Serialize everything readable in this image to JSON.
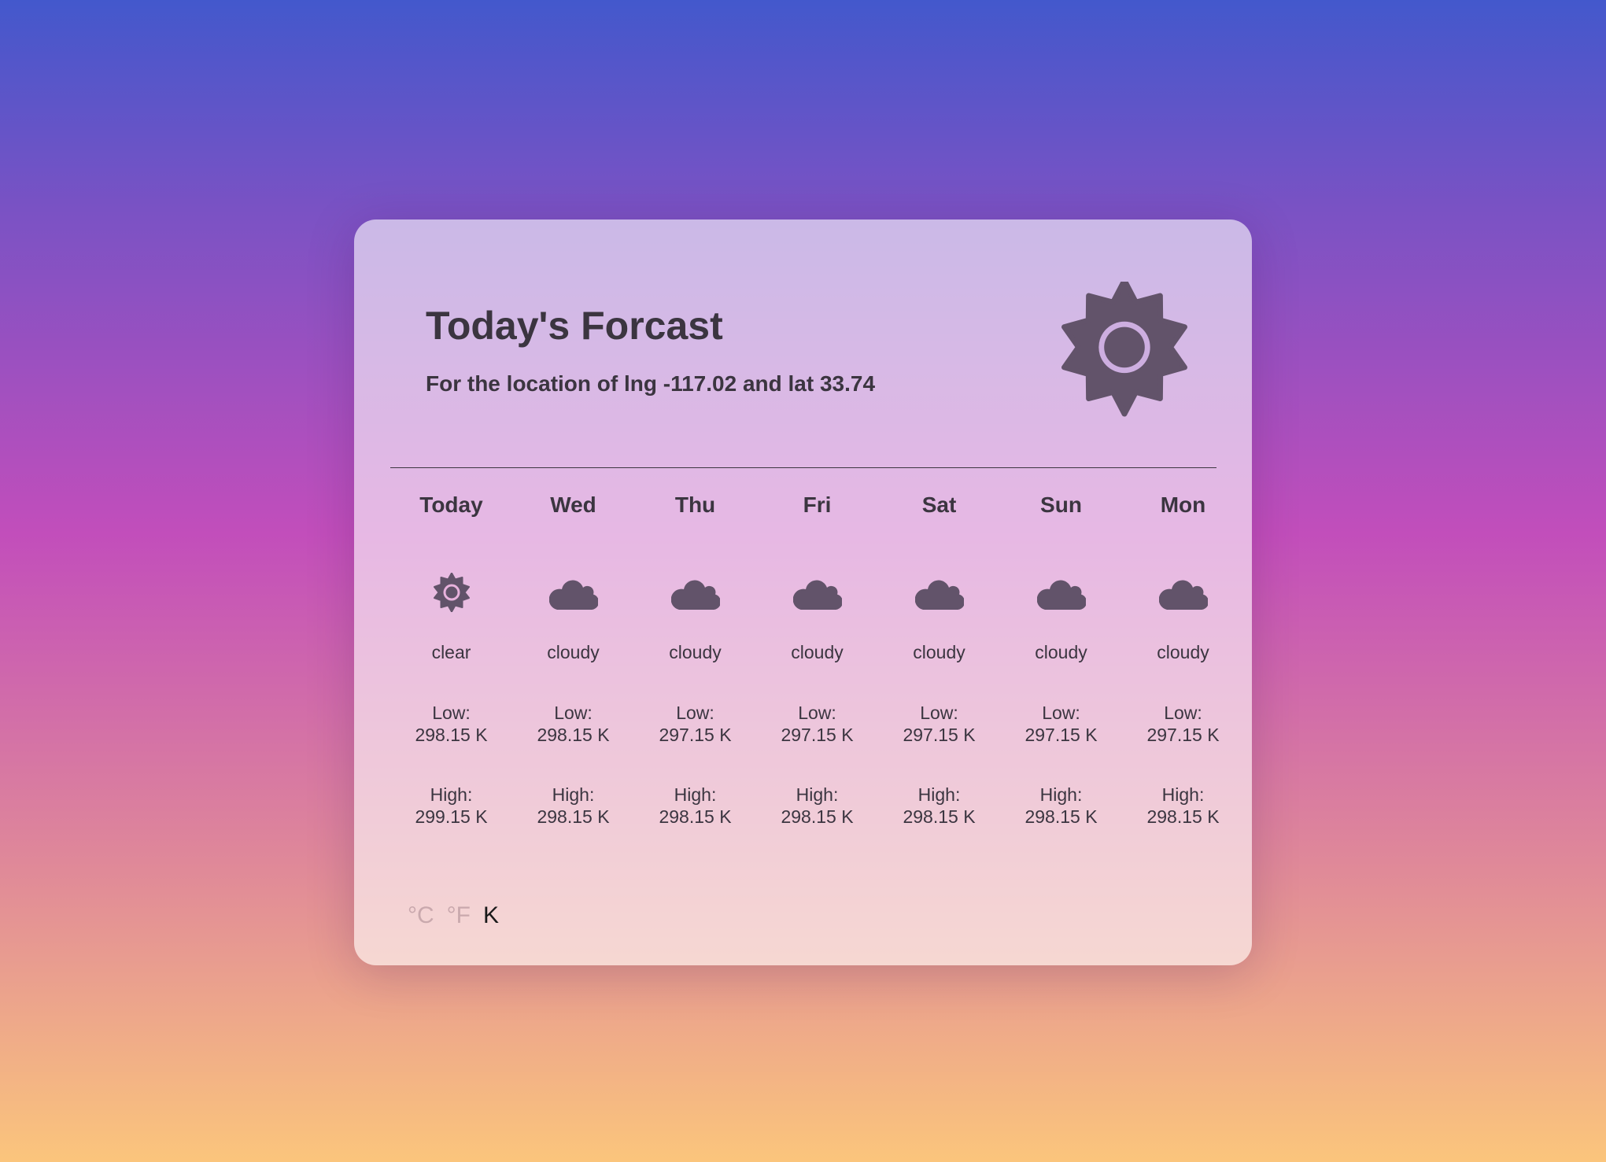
{
  "header": {
    "title": "Today's Forcast",
    "subtitle": "For the location of lng -117.02 and lat 33.74",
    "icon": "sun-icon"
  },
  "colors": {
    "icon": "#62536a",
    "text": "#3b3540",
    "active_unit": "#1a1a1a"
  },
  "days": [
    {
      "name": "Today",
      "icon": "sun-icon",
      "condition": "clear",
      "low_label": "Low:",
      "low": "298.15 K",
      "high_label": "High:",
      "high": "299.15 K"
    },
    {
      "name": "Wed",
      "icon": "cloud-icon",
      "condition": "cloudy",
      "low_label": "Low:",
      "low": "298.15 K",
      "high_label": "High:",
      "high": "298.15 K"
    },
    {
      "name": "Thu",
      "icon": "cloud-icon",
      "condition": "cloudy",
      "low_label": "Low:",
      "low": "297.15 K",
      "high_label": "High:",
      "high": "298.15 K"
    },
    {
      "name": "Fri",
      "icon": "cloud-icon",
      "condition": "cloudy",
      "low_label": "Low:",
      "low": "297.15 K",
      "high_label": "High:",
      "high": "298.15 K"
    },
    {
      "name": "Sat",
      "icon": "cloud-icon",
      "condition": "cloudy",
      "low_label": "Low:",
      "low": "297.15 K",
      "high_label": "High:",
      "high": "298.15 K"
    },
    {
      "name": "Sun",
      "icon": "cloud-icon",
      "condition": "cloudy",
      "low_label": "Low:",
      "low": "297.15 K",
      "high_label": "High:",
      "high": "298.15 K"
    },
    {
      "name": "Mon",
      "icon": "cloud-icon",
      "condition": "cloudy",
      "low_label": "Low:",
      "low": "297.15 K",
      "high_label": "High:",
      "high": "298.15 K"
    }
  ],
  "units": {
    "celsius": "°C",
    "fahrenheit": "°F",
    "kelvin": "K",
    "selected": "K"
  }
}
